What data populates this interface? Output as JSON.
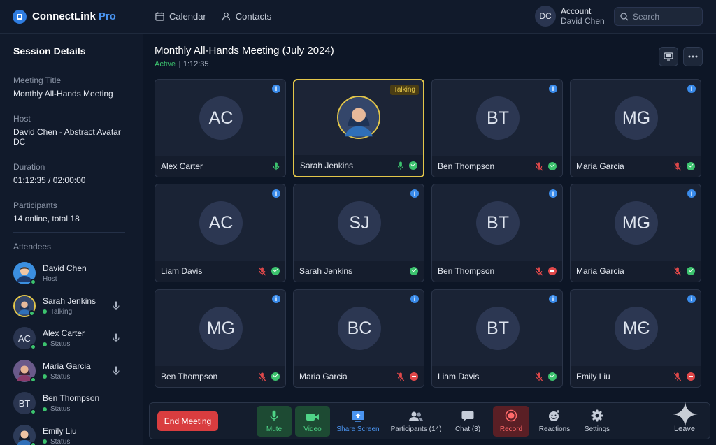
{
  "app": {
    "name": "ConnectLink",
    "tier": "Pro"
  },
  "topnav": {
    "calendar": "Calendar",
    "contacts": "Contacts"
  },
  "account": {
    "initials": "DC",
    "label": "Account",
    "name": "David Chen"
  },
  "search": {
    "placeholder": "Search"
  },
  "sidebar": {
    "title": "Session Details",
    "fields": [
      {
        "label": "Meeting Title",
        "value": "Monthly All-Hands Meeting"
      },
      {
        "label": "Host",
        "value": "David Chen - Abstract Avatar DC"
      },
      {
        "label": "Duration",
        "value": "01:12:35 / 02:00:00"
      },
      {
        "label": "Participants",
        "value": "14 online, total 18"
      }
    ],
    "attendees_label": "Attendees",
    "attendees": [
      {
        "name": "David Chen",
        "status": "Host",
        "avatar": "photo"
      },
      {
        "name": "Sarah Jenkins",
        "status": "Talking",
        "avatar": "photo"
      },
      {
        "name": "Alex Carter",
        "status": "Status",
        "initials": "AC"
      },
      {
        "name": "Maria Garcia",
        "status": "Status",
        "avatar": "photo"
      },
      {
        "name": "Ben Thompson",
        "status": "Status",
        "initials": "BT"
      },
      {
        "name": "Emily Liu",
        "status": "Status",
        "avatar": "photo"
      }
    ]
  },
  "meeting": {
    "title": "Monthly All-Hands Meeting (July 2024)",
    "state": "Active",
    "elapsed": "1:12:35",
    "talking_badge": "Talking"
  },
  "tiles": [
    {
      "name": "Alex Carter",
      "initials": "AC",
      "mic": "on",
      "status": ""
    },
    {
      "name": "Sarah Jenkins",
      "initials": "",
      "mic": "on",
      "status": "ok",
      "talking": true
    },
    {
      "name": "Ben Thompson",
      "initials": "BT",
      "mic": "muted",
      "status": "ok"
    },
    {
      "name": "Maria Garcia",
      "initials": "MG",
      "mic": "muted",
      "status": "ok"
    },
    {
      "name": "Liam Davis",
      "initials": "AC",
      "mic": "muted",
      "status": "ok"
    },
    {
      "name": "Sarah Jenkins",
      "initials": "SJ",
      "mic": "",
      "status": "ok"
    },
    {
      "name": "Ben Thompson",
      "initials": "BT",
      "mic": "muted",
      "status": "no"
    },
    {
      "name": "Maria Garcia",
      "initials": "MG",
      "mic": "muted",
      "status": "ok"
    },
    {
      "name": "Ben Thompson",
      "initials": "MG",
      "mic": "muted",
      "status": "ok"
    },
    {
      "name": "Maria Garcia",
      "initials": "BC",
      "mic": "muted",
      "status": "no"
    },
    {
      "name": "Liam Davis",
      "initials": "BT",
      "mic": "muted",
      "status": "ok"
    },
    {
      "name": "Emily Liu",
      "initials": "MЄ",
      "mic": "muted",
      "status": "no"
    }
  ],
  "toolbar": {
    "end_label": "End Meeting",
    "mute": "Mute",
    "video": "Video",
    "share": "Share Screen",
    "participants": "Participants (14)",
    "chat": "Chat (3)",
    "record": "Record",
    "reactions": "Reactions",
    "settings": "Settings",
    "leave": "Leave"
  },
  "colors": {
    "accent": "#4a94f0",
    "talking": "#e3c64a",
    "online": "#3cc36e",
    "danger": "#d93d3f"
  }
}
